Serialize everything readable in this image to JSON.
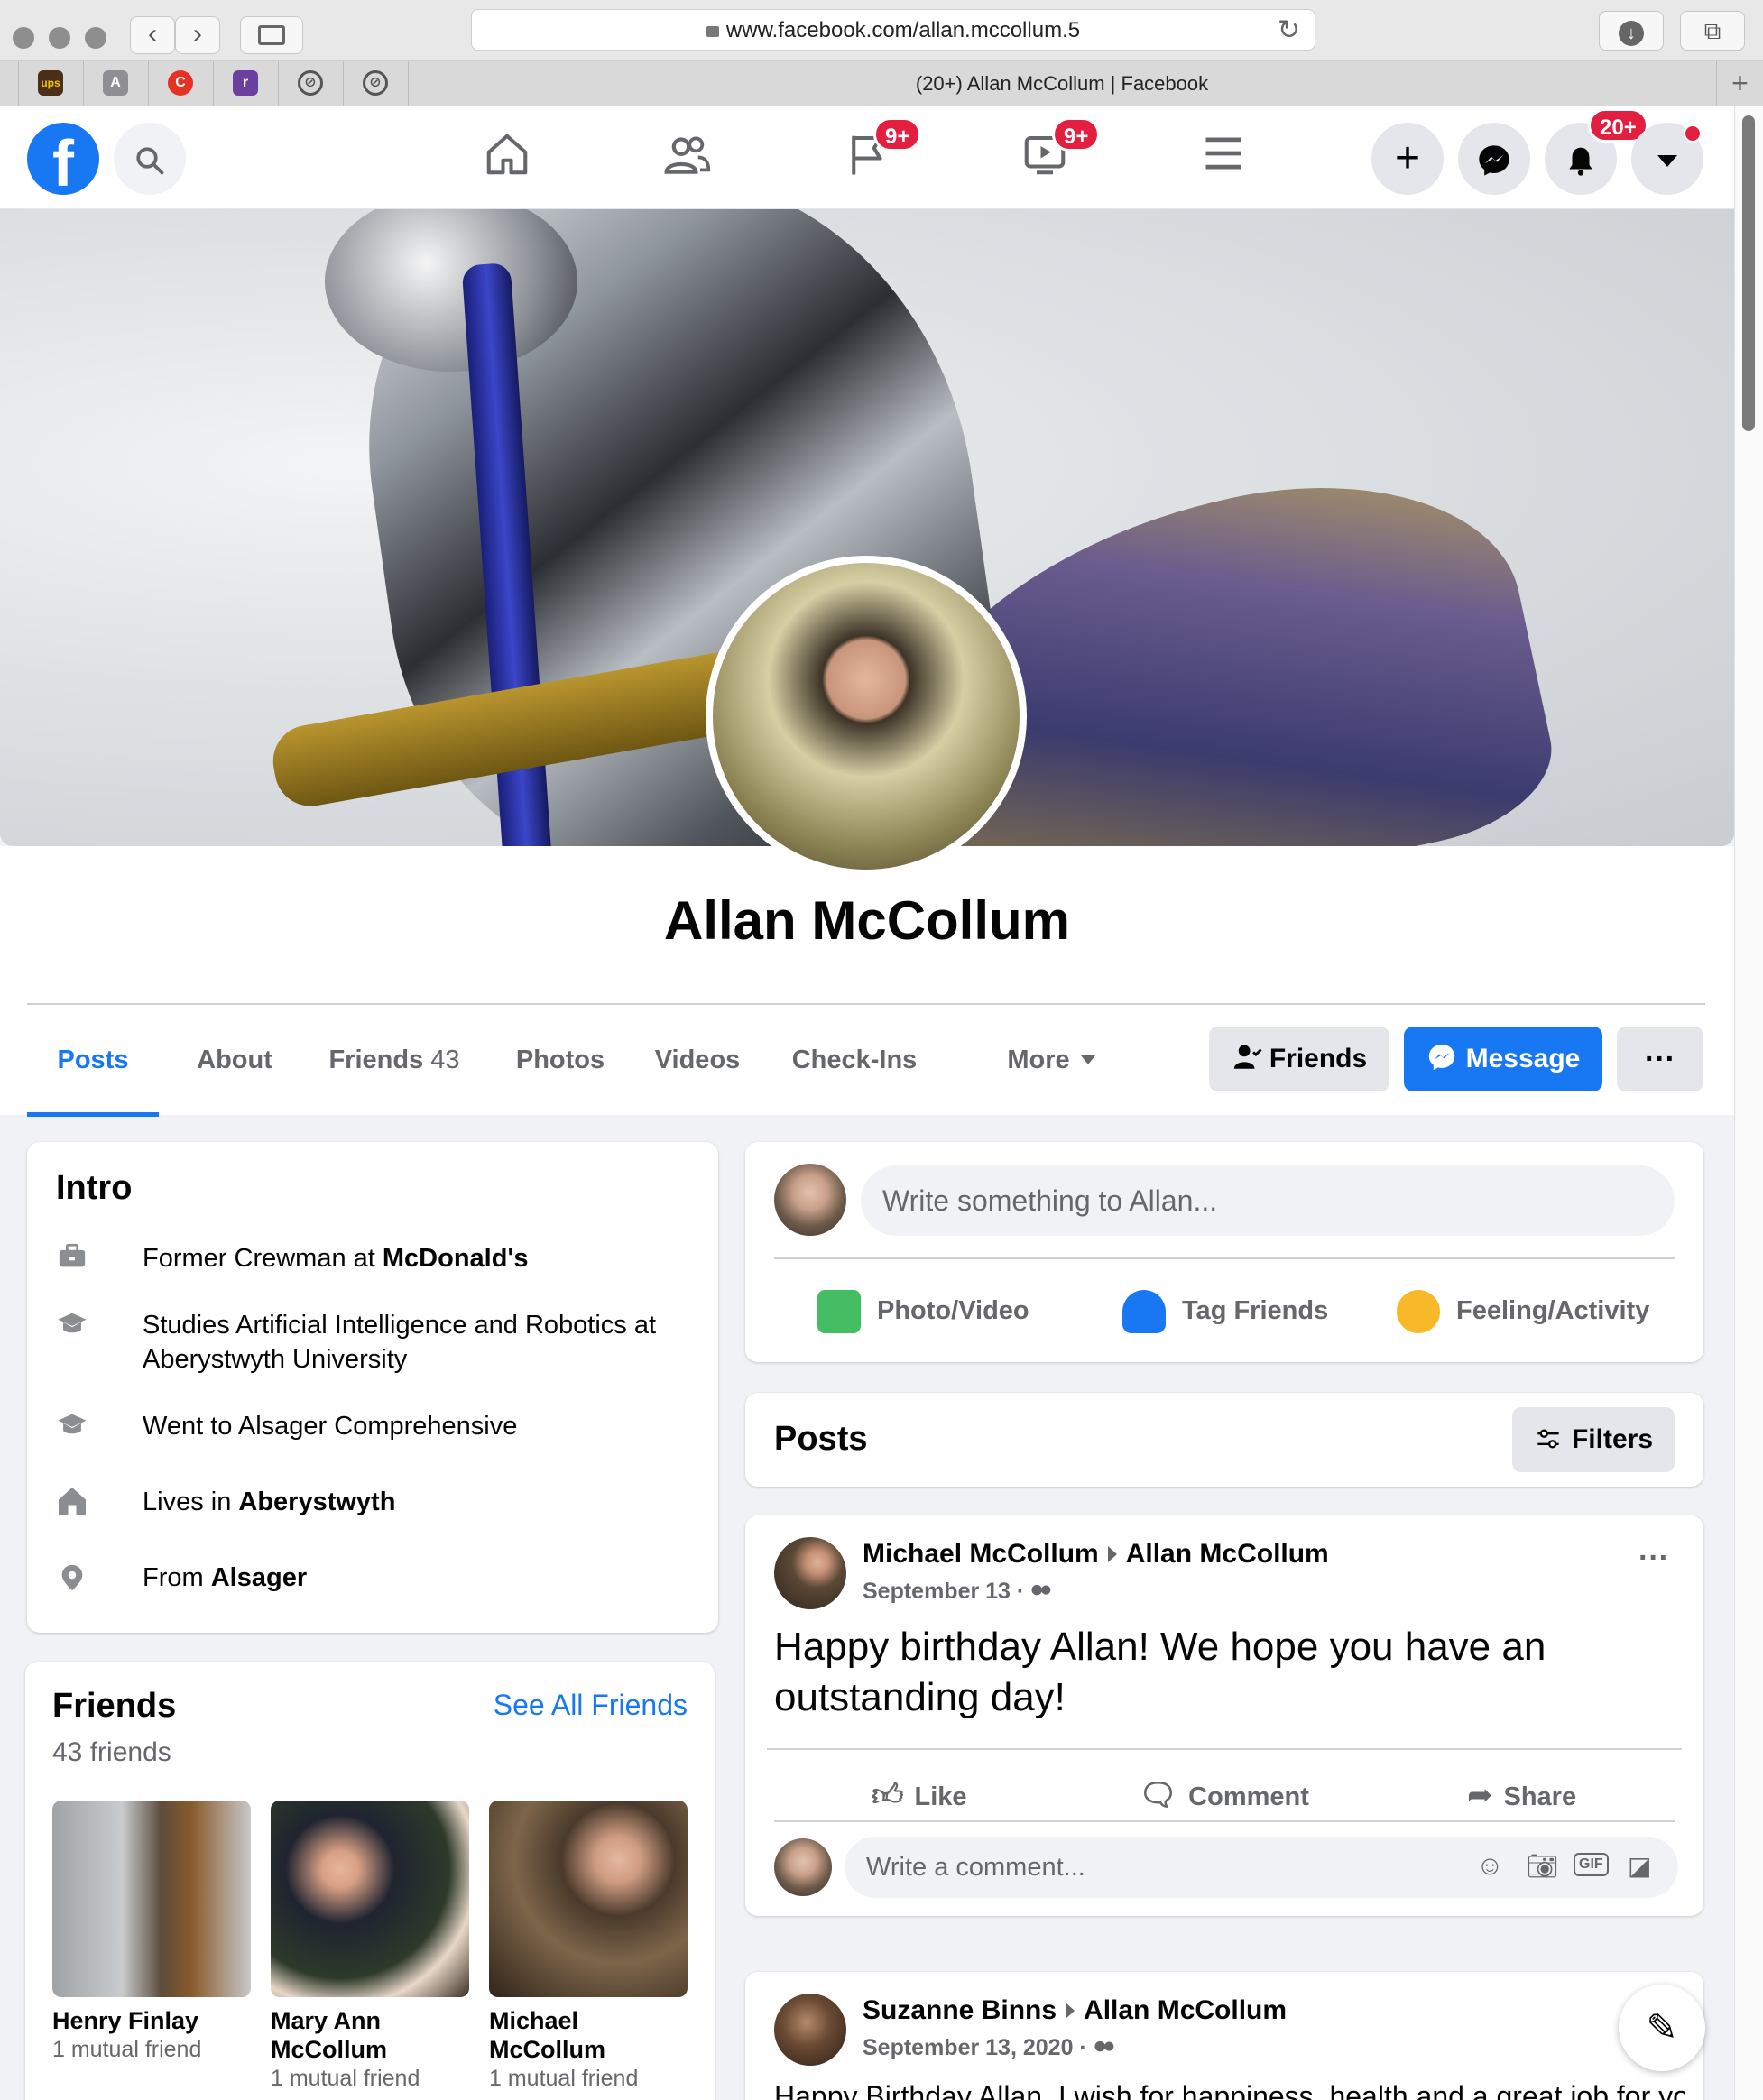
{
  "browser": {
    "url": "www.facebook.com/allan.mccollum.5",
    "tab_title": "(20+) Allan McCollum | Facebook",
    "favicons": [
      "ups",
      "A",
      "C",
      "r"
    ],
    "tab_add": "+"
  },
  "topnav": {
    "logo": "f",
    "groups_badge": "9+",
    "watch_badge": "9+",
    "notifications_badge": "20+",
    "create": "+",
    "icons": {
      "search": "search-icon",
      "home": "home-icon",
      "friends": "friends-icon",
      "pages": "flag-icon",
      "watch": "video-icon",
      "menu": "menu-icon",
      "messenger": "messenger-icon",
      "notifications": "bell-icon",
      "account": "caret-down-icon"
    }
  },
  "profile": {
    "name": "Allan McCollum"
  },
  "tabs": [
    {
      "label": "Posts"
    },
    {
      "label": "About"
    },
    {
      "label": "Friends",
      "count": "43"
    },
    {
      "label": "Photos"
    },
    {
      "label": "Videos"
    },
    {
      "label": "Check-Ins"
    },
    {
      "label": "More"
    }
  ],
  "actions": {
    "friends": "Friends",
    "message": "Message",
    "more": "···"
  },
  "intro": {
    "title": "Intro",
    "work": {
      "prefix": "Former Crewman at ",
      "place": "McDonald's"
    },
    "study": "Studies Artificial Intelligence and Robotics at Aberystwyth University",
    "school": "Went to Alsager Comprehensive",
    "lives": {
      "prefix": "Lives in ",
      "place": "Aberystwyth"
    },
    "from": {
      "prefix": "From ",
      "place": "Alsager"
    }
  },
  "friends_card": {
    "title": "Friends",
    "count_text": "43 friends",
    "see_all": "See All Friends",
    "items": [
      {
        "name": "Henry Finlay",
        "mutual": "1 mutual friend"
      },
      {
        "name": "Mary Ann McCollum",
        "mutual": "1 mutual friend"
      },
      {
        "name": "Michael McCollum",
        "mutual": "1 mutual friend"
      }
    ]
  },
  "composer": {
    "placeholder": "Write something to Allan...",
    "photo_video": "Photo/Video",
    "tag_friends": "Tag Friends",
    "feeling": "Feeling/Activity"
  },
  "posts_header": {
    "title": "Posts",
    "filters": "Filters"
  },
  "posts": [
    {
      "author": "Michael McCollum",
      "target": "Allan McCollum",
      "date": "September 13 · ",
      "body": "Happy birthday Allan! We hope you have an outstanding day!",
      "like": "Like",
      "comment": "Comment",
      "share": "Share",
      "comment_placeholder": "Write a comment..."
    },
    {
      "author": "Suzanne Binns",
      "target": "Allan McCollum",
      "date": "September 13, 2020 · ",
      "body": "Happy Birthday Allan. I wish for happiness, health and a great job for you"
    }
  ],
  "colors": {
    "brand": "#1877f2",
    "badge": "#e41e3f",
    "text_secondary": "#65676b"
  }
}
